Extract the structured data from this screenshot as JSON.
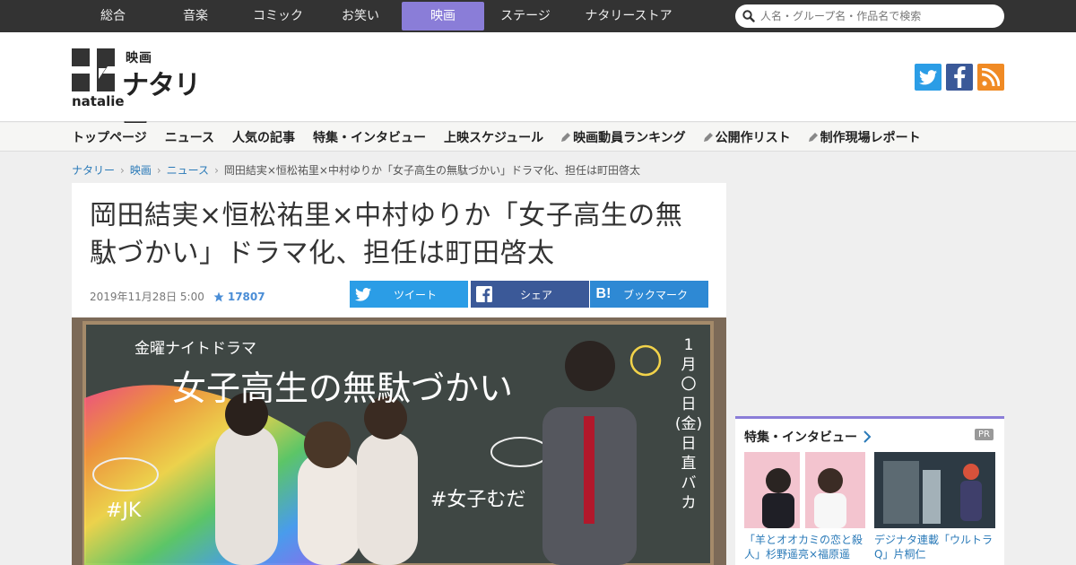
{
  "genres": [
    "総合",
    "音楽",
    "コミック",
    "お笑い",
    "映画",
    "ステージ",
    "ナタリーストア"
  ],
  "active_genre": "映画",
  "search": {
    "placeholder": "人名・グループ名・作品名で検索"
  },
  "logo": {
    "sub": "映画",
    "name": "ナタリー",
    "roman": "natalie"
  },
  "social": {
    "twitter": "twitter-icon",
    "facebook": "facebook-icon",
    "rss": "rss-icon"
  },
  "subnav": {
    "items": [
      "トップページ",
      "ニュース",
      "人気の記事",
      "特集・インタビュー",
      "上映スケジュール"
    ],
    "tag_items": [
      "映画動員ランキング",
      "公開作リスト",
      "制作現場レポート"
    ]
  },
  "breadcrumb": {
    "items": [
      "ナタリー",
      "映画",
      "ニュース"
    ],
    "current": "岡田結実×恒松祐里×中村ゆりか「女子高生の無駄づかい」ドラマ化、担任は町田啓太"
  },
  "article": {
    "title_line1": "岡田結実×恒松祐里×中村ゆりか「女子高生の無",
    "title_line2": "駄づかい」ドラマ化、担任は町田啓太",
    "date": "2019年11月28日 5:00",
    "stars": "17807",
    "share": {
      "tweet": "ツイート",
      "share": "シェア",
      "bookmark": "ブックマーク"
    }
  },
  "hero": {
    "chalk_top": "金曜ナイトドラマ",
    "chalk_title": "女子高生の無駄づかい",
    "chalk_side": [
      "1",
      "月",
      "〇",
      "日",
      "(金)",
      "日",
      "直",
      "バ",
      "カ"
    ],
    "chalk_left": "#JK",
    "chalk_right": "#女子むだ"
  },
  "sidebar": {
    "title": "特集・インタビュー",
    "pr": "PR",
    "cards": [
      {
        "caption": "「羊とオオカミの恋と殺人」杉野遥亮×福原遥"
      },
      {
        "caption": "デジナタ連載「ウルトラQ」片桐仁"
      }
    ]
  },
  "colors": {
    "accent": "#8a7dd8",
    "topbar": "#333333",
    "link": "#2a7ab8",
    "twitter": "#2b9de6",
    "facebook": "#3b5998",
    "hatena": "#2e89d4"
  }
}
